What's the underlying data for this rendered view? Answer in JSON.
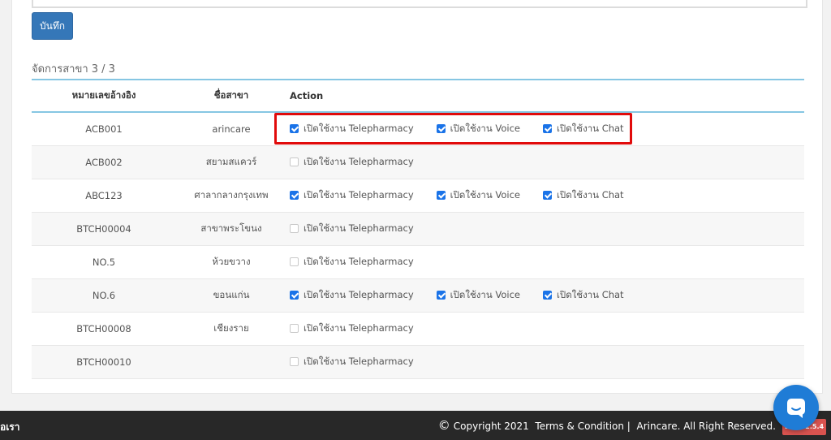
{
  "form": {
    "save_label": "บันทึก"
  },
  "branches": {
    "title": "จัดการสาขา 3 / 3",
    "columns": {
      "ref": "หมายเลขอ้างอิง",
      "name": "ชื่อสาขา",
      "action": "Action"
    },
    "labels": {
      "telepharmacy": "เปิดใช้งาน Telepharmacy",
      "voice": "เปิดใช้งาน Voice",
      "chat": "เปิดใช้งาน Chat"
    },
    "rows": [
      {
        "ref": "ACB001",
        "name": "arincare",
        "telepharmacy": true,
        "voice": true,
        "chat": true
      },
      {
        "ref": "ACB002",
        "name": "สยามสแควร์",
        "telepharmacy": false,
        "voice": null,
        "chat": null
      },
      {
        "ref": "ABC123",
        "name": "ศาลากลางกรุงเทพ",
        "telepharmacy": true,
        "voice": true,
        "chat": true
      },
      {
        "ref": "BTCH00004",
        "name": "สาขาพระโขนง",
        "telepharmacy": false,
        "voice": null,
        "chat": null
      },
      {
        "ref": "NO.5",
        "name": "ห้วยขวาง",
        "telepharmacy": false,
        "voice": null,
        "chat": null
      },
      {
        "ref": "NO.6",
        "name": "ขอนแก่น",
        "telepharmacy": true,
        "voice": true,
        "chat": true
      },
      {
        "ref": "BTCH00008",
        "name": "เชียงราย",
        "telepharmacy": false,
        "voice": null,
        "chat": null
      },
      {
        "ref": "BTCH00010",
        "name": "",
        "telepharmacy": false,
        "voice": null,
        "chat": null
      }
    ]
  },
  "footer": {
    "left_text": "อเรา",
    "copyright": "Copyright 2021",
    "terms": "Terms & Condition |",
    "company": "Arincare. All Right Reserved.",
    "version_badge": "BETA 2.5.4"
  },
  "colors": {
    "primary": "#3577b8",
    "highlight": "#e10b0b",
    "badge": "#d9534f",
    "chat": "#1f7cd6"
  },
  "icons": {
    "chat": "chat-bubble-icon",
    "copyright": "copyright-icon"
  }
}
